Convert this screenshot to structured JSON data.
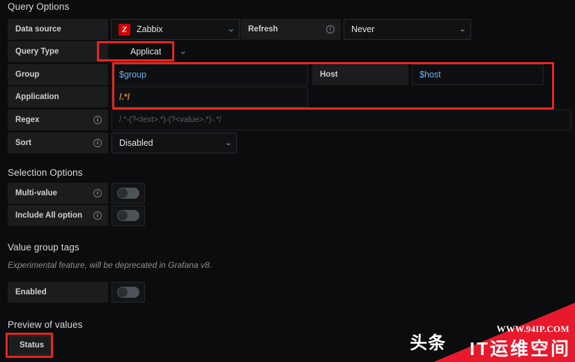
{
  "sections": {
    "query_options": "Query Options",
    "selection_options": "Selection Options",
    "value_group_tags": "Value group tags",
    "value_group_tags_note": "Experimental feature, will be deprecated in Grafana v8.",
    "preview_of_values": "Preview of values"
  },
  "query_options": {
    "data_source": {
      "label": "Data source",
      "value": "Zabbix",
      "logo_text": "Z",
      "logo_color": "#d40000"
    },
    "refresh": {
      "label": "Refresh",
      "value": "Never"
    },
    "query_type": {
      "label": "Query Type",
      "value": "Applicat"
    },
    "group": {
      "label": "Group",
      "value": "$group"
    },
    "host": {
      "label": "Host",
      "value": "$host"
    },
    "application": {
      "label": "Application",
      "value": "/.*/"
    },
    "regex": {
      "label": "Regex",
      "placeholder": "/.*-(?<text>.*)-(?<value>.*)-.*/"
    },
    "sort": {
      "label": "Sort",
      "value": "Disabled"
    }
  },
  "selection_options": {
    "multi_value": {
      "label": "Multi-value",
      "state": "off"
    },
    "include_all": {
      "label": "Include All option",
      "state": "off"
    }
  },
  "value_group_tags": {
    "enabled": {
      "label": "Enabled",
      "state": "off"
    }
  },
  "preview": {
    "status_chip": "Status"
  },
  "watermark": {
    "url": "WWW.94IP.COM",
    "brand_cn": "IT运维空间",
    "toutiao": "头条",
    "accent_color": "#e8192c"
  },
  "annotation": {
    "color": "#e8271f"
  }
}
